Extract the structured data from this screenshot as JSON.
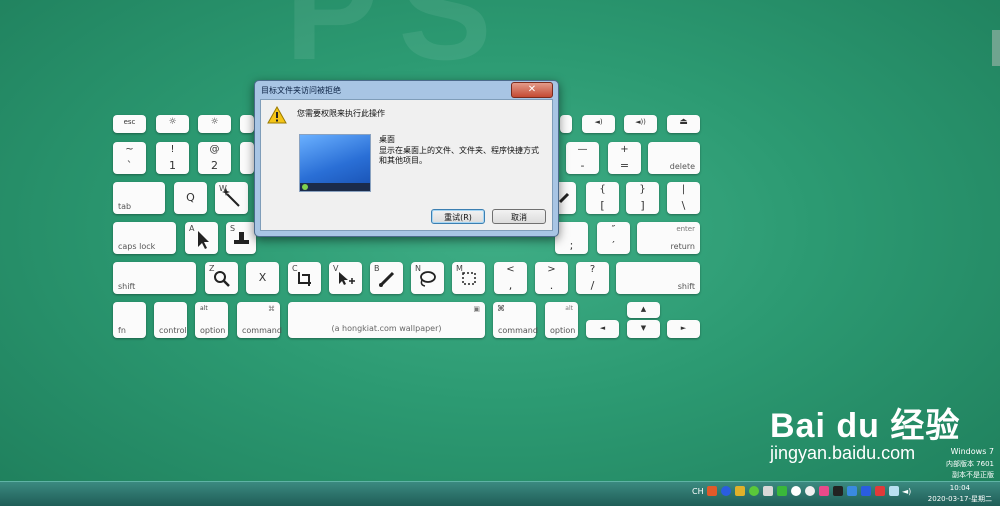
{
  "keyboard": {
    "row1": {
      "esc": "esc",
      "f1": "☼",
      "f2": "☼",
      "f10": "◄)",
      "f11": "◄))",
      "eject": "⏏"
    },
    "row2": {
      "tilde_top": "~",
      "tilde_bot": "`",
      "one_top": "!",
      "one_bot": "1",
      "two_top": "@",
      "two_bot": "2",
      "minus_top": "—",
      "minus_bot": "-",
      "plus_top": "+",
      "plus_bot": "=",
      "delete": "delete"
    },
    "row3": {
      "tab": "tab",
      "q": "Q",
      "w": "W",
      "lbrace_top": "{",
      "lbrace_bot": "[",
      "rbrace_top": "}",
      "rbrace_bot": "]",
      "pipe_top": "|",
      "pipe_bot": "\\"
    },
    "row4": {
      "caps": "caps lock",
      "a": "A",
      "s": "S",
      "colon_bot": ";",
      "quote_top": "″",
      "quote_bot": "′",
      "enter": "enter",
      "return": "return"
    },
    "row5": {
      "shift_l": "shift",
      "z": "Z",
      "x": "X",
      "c": "C",
      "v": "V",
      "b": "B",
      "n": "N",
      "m": "M",
      "lt_top": "<",
      "lt_bot": ",",
      "gt_top": ">",
      "gt_bot": ".",
      "q_top": "?",
      "q_bot": "/",
      "shift_r": "shift"
    },
    "row6": {
      "fn": "fn",
      "control": "control",
      "alt": "alt",
      "option": "option",
      "cmd_sym": "⌘",
      "command": "command",
      "space": "(a hongkiat.com wallpaper)",
      "alt2": "alt",
      "option2": "option",
      "command2": "command",
      "left": "◄",
      "up": "▲",
      "down": "▼",
      "right": "►"
    }
  },
  "dialog": {
    "title": "目标文件夹访问被拒绝",
    "close": "✕",
    "message": "您需要权限来执行此操作",
    "item_name": "桌面",
    "item_desc": "显示在桌面上的文件、文件夹、程序快捷方式和其他项目。",
    "retry": "重试(R)",
    "cancel": "取消"
  },
  "watermark": {
    "os": "Windows 7",
    "build": "内部版本 7601",
    "genuine": "副本不是正版"
  },
  "baidu": {
    "brand": "Bai du 经验",
    "url": "jingyan.baidu.com"
  },
  "taskbar": {
    "lang": "CH",
    "time": "10:04",
    "date": "2020-03-17-星期二",
    "colors": {
      "bar": "#2a7068"
    }
  }
}
